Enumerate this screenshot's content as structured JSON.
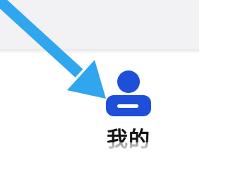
{
  "tab_bar": {
    "mine": {
      "label": "我的",
      "icon": "person-icon",
      "color": "#1e4fd8"
    }
  },
  "annotation": {
    "icon": "pointer-arrow-icon",
    "color": "#2fa6ee"
  }
}
